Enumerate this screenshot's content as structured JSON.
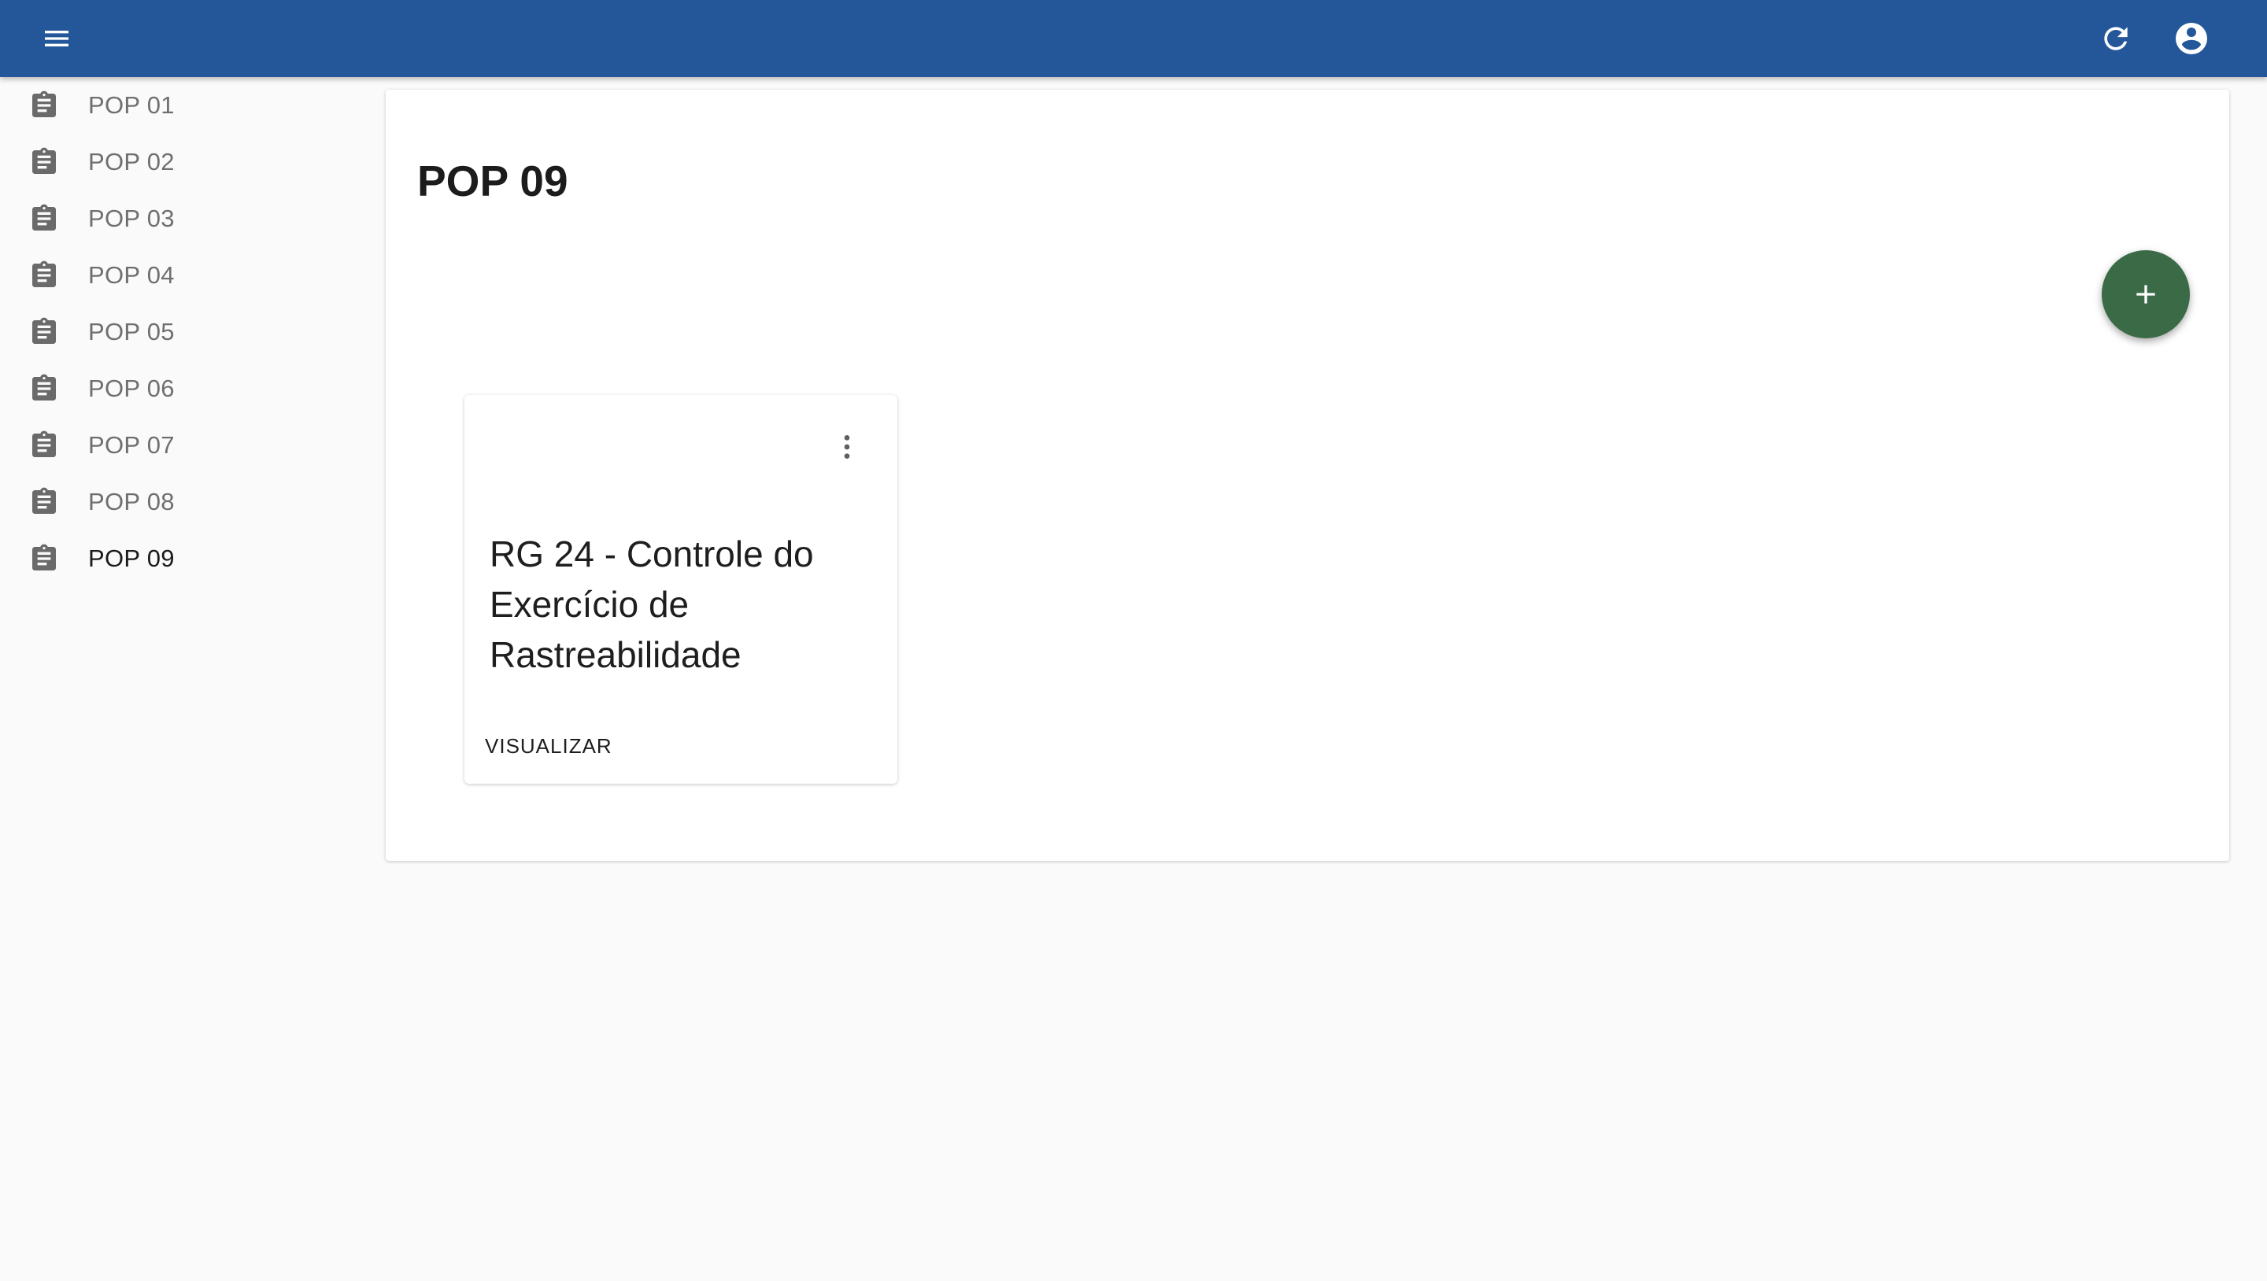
{
  "topbar": {
    "menu_icon": "menu-icon",
    "refresh_icon": "refresh-icon",
    "account_icon": "account-circle-icon",
    "background_color": "#245799"
  },
  "sidebar": {
    "items": [
      {
        "label": "POP 01",
        "icon": "clipboard-text-icon",
        "active": false
      },
      {
        "label": "POP 02",
        "icon": "clipboard-text-icon",
        "active": false
      },
      {
        "label": "POP 03",
        "icon": "clipboard-text-icon",
        "active": false
      },
      {
        "label": "POP 04",
        "icon": "clipboard-text-icon",
        "active": false
      },
      {
        "label": "POP 05",
        "icon": "clipboard-text-icon",
        "active": false
      },
      {
        "label": "POP 06",
        "icon": "clipboard-text-icon",
        "active": false
      },
      {
        "label": "POP 07",
        "icon": "clipboard-text-icon",
        "active": false
      },
      {
        "label": "POP 08",
        "icon": "clipboard-text-icon",
        "active": false
      },
      {
        "label": "POP 09",
        "icon": "clipboard-text-icon",
        "active": true
      }
    ]
  },
  "main": {
    "title": "POP 09",
    "fab_icon": "plus-icon",
    "fab_color": "#3a6b46",
    "cards": [
      {
        "title": "RG 24 - Controle do Exercício de Rastreabilidade",
        "menu_icon": "more-vertical-icon",
        "action_label": "VISUALIZAR"
      }
    ]
  }
}
